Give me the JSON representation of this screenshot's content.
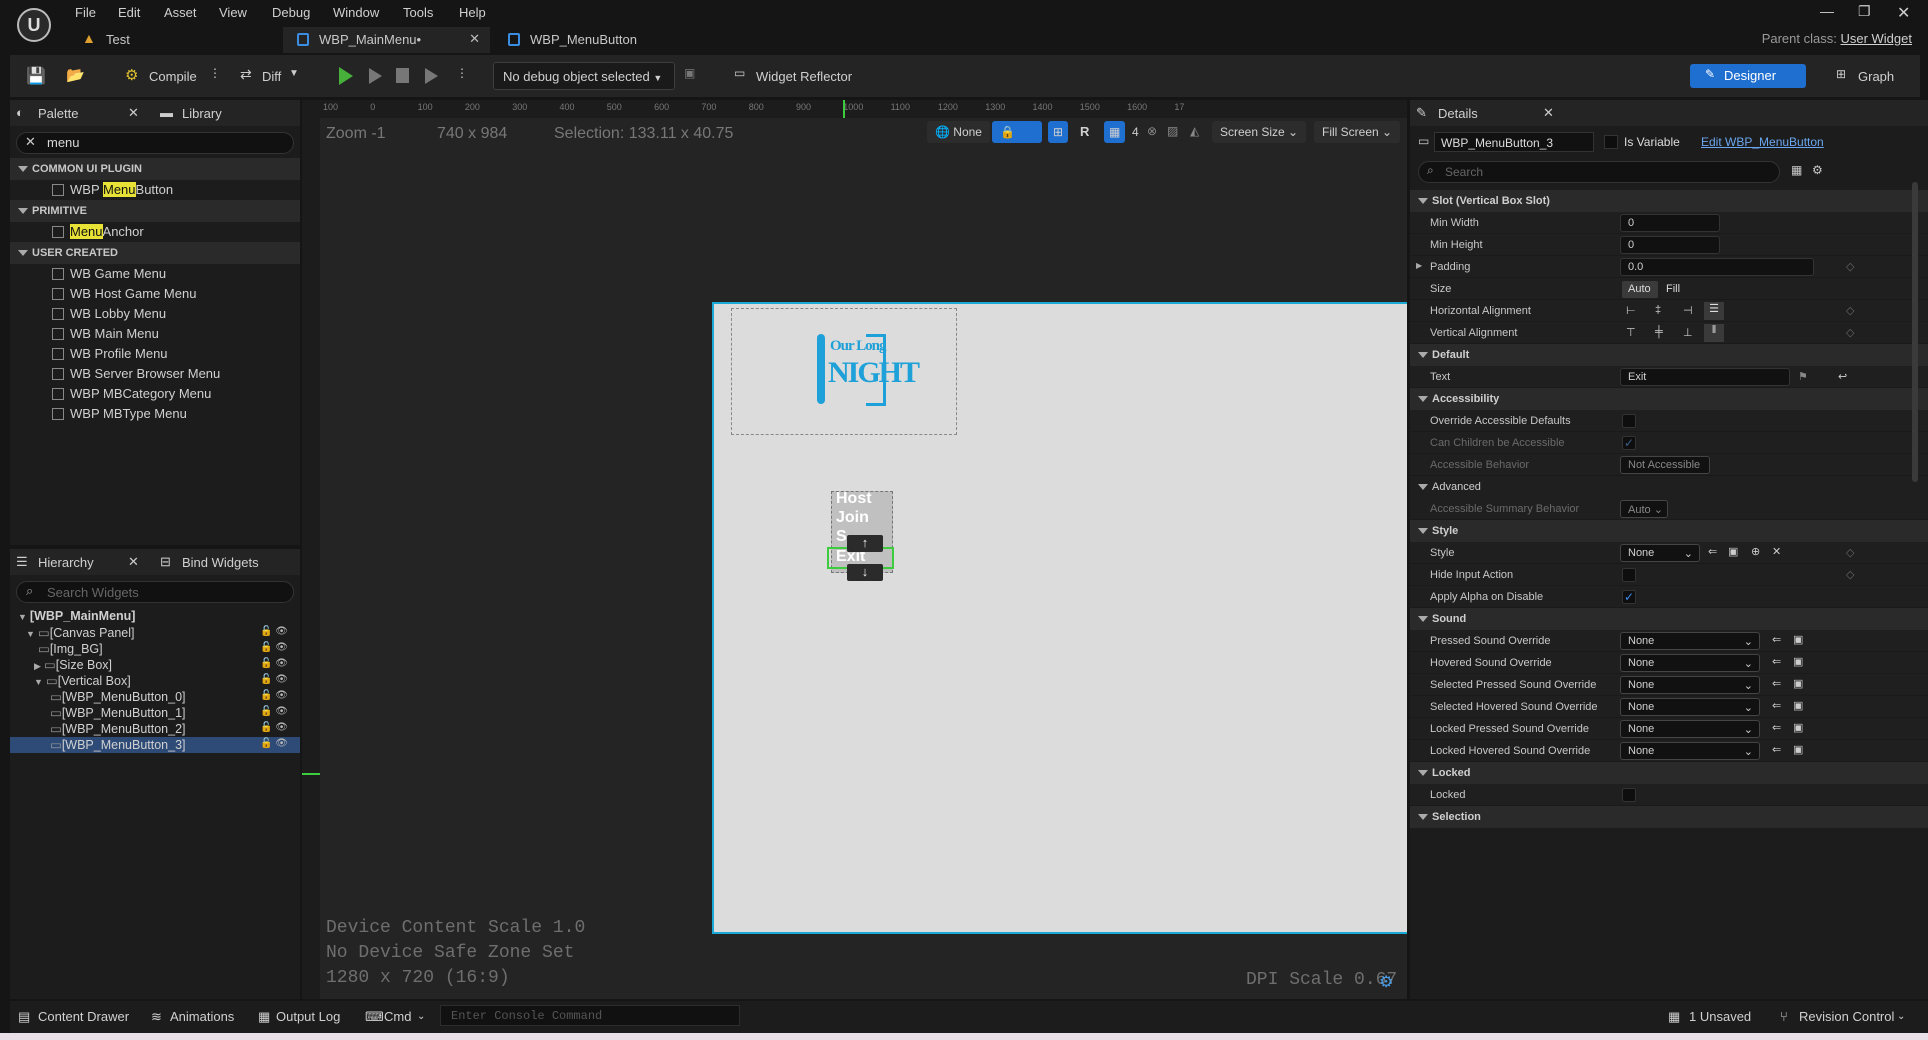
{
  "menu": [
    "File",
    "Edit",
    "Asset",
    "View",
    "Debug",
    "Window",
    "Tools",
    "Help"
  ],
  "parent_class_label": "Parent class:",
  "parent_class_value": "User Widget",
  "tabs": [
    "Test",
    "WBP_MainMenu•",
    "WBP_MenuButton"
  ],
  "toolbar": {
    "compile": "Compile",
    "diff": "Diff",
    "debug_select": "No debug object selected",
    "widget_reflector": "Widget Reflector",
    "designer": "Designer",
    "graph": "Graph"
  },
  "palette": {
    "title": "Palette",
    "library": "Library",
    "search": "menu",
    "categories": [
      {
        "name": "COMMON UI PLUGIN",
        "items": [
          {
            "pre": "WBP ",
            "hl": "Menu",
            "post": "Button"
          }
        ]
      },
      {
        "name": "PRIMITIVE",
        "items": [
          {
            "pre": "",
            "hl": "Menu",
            "post": "Anchor"
          }
        ]
      },
      {
        "name": "USER CREATED",
        "items": [
          {
            "pre": "WB Game Menu",
            "hl": "",
            "post": ""
          },
          {
            "pre": "WB Host Game Menu",
            "hl": "",
            "post": ""
          },
          {
            "pre": "WB Lobby Menu",
            "hl": "",
            "post": ""
          },
          {
            "pre": "WB Main Menu",
            "hl": "",
            "post": ""
          },
          {
            "pre": "WB Profile Menu",
            "hl": "",
            "post": ""
          },
          {
            "pre": "WB Server Browser Menu",
            "hl": "",
            "post": ""
          },
          {
            "pre": "WBP MBCategory Menu",
            "hl": "",
            "post": ""
          },
          {
            "pre": "WBP MBType Menu",
            "hl": "",
            "post": ""
          }
        ]
      }
    ]
  },
  "hierarchy": {
    "title": "Hierarchy",
    "bind": "Bind Widgets",
    "search_placeholder": "Search Widgets",
    "rows": [
      "[WBP_MainMenu]",
      "[Canvas Panel]",
      "[Img_BG]",
      "[Size Box]",
      "[Vertical Box]",
      "[WBP_MenuButton_0]",
      "[WBP_MenuButton_1]",
      "[WBP_MenuButton_2]",
      "[WBP_MenuButton_3]"
    ]
  },
  "viewport": {
    "zoom": "Zoom -1",
    "size": "740 x 984",
    "selection": "Selection: 133.11 x 40.75",
    "none": "None",
    "r": "R",
    "grid": "4",
    "screen_size": "Screen Size",
    "fill_screen": "Fill Screen",
    "ruler": [
      "100",
      "0",
      "100",
      "200",
      "300",
      "400",
      "500",
      "600",
      "700",
      "800",
      "900",
      "1000",
      "1100",
      "1200",
      "1300",
      "1400",
      "1500",
      "1600",
      "17"
    ],
    "logo_line1": "Our Long",
    "logo_line2": "NIGHT",
    "buttons": [
      "Host",
      "Join",
      "S",
      "Exit"
    ],
    "device_scale": "Device Content Scale 1.0",
    "safe_zone": "No Device Safe Zone Set",
    "resolution": "1280 x 720 (16:9)",
    "dpi": "DPI Scale 0.67"
  },
  "details": {
    "title": "Details",
    "widget_name": "WBP_MenuButton_3",
    "is_variable": "Is Variable",
    "edit_link": "Edit WBP_MenuButton",
    "search": "Search",
    "slot": "Slot (Vertical Box Slot)",
    "min_width": "Min Width",
    "min_width_val": "0",
    "min_height": "Min Height",
    "min_height_val": "0",
    "padding": "Padding",
    "padding_val": "0.0",
    "size": "Size",
    "auto": "Auto",
    "fill": "Fill",
    "h_align": "Horizontal Alignment",
    "v_align": "Vertical Alignment",
    "default": "Default",
    "text": "Text",
    "text_val": "Exit",
    "accessibility": "Accessibility",
    "override": "Override Accessible Defaults",
    "can_children": "Can Children be Accessible",
    "acc_behavior": "Accessible Behavior",
    "not_accessible": "Not Accessible",
    "advanced": "Advanced",
    "acc_summary": "Accessible Summary Behavior",
    "auto_val": "Auto",
    "style_sec": "Style",
    "style": "Style",
    "none": "None",
    "hide_input": "Hide Input Action",
    "apply_alpha": "Apply Alpha on Disable",
    "sound": "Sound",
    "sounds": [
      "Pressed Sound Override",
      "Hovered Sound Override",
      "Selected Pressed Sound Override",
      "Selected Hovered Sound Override",
      "Locked Pressed Sound Override",
      "Locked Hovered Sound Override"
    ],
    "locked_sec": "Locked",
    "locked": "Locked",
    "selection": "Selection"
  },
  "statusbar": {
    "content_drawer": "Content Drawer",
    "animations": "Animations",
    "output_log": "Output Log",
    "cmd": "Cmd",
    "console_placeholder": "Enter Console Command",
    "unsaved": "1 Unsaved",
    "revision": "Revision Control"
  }
}
